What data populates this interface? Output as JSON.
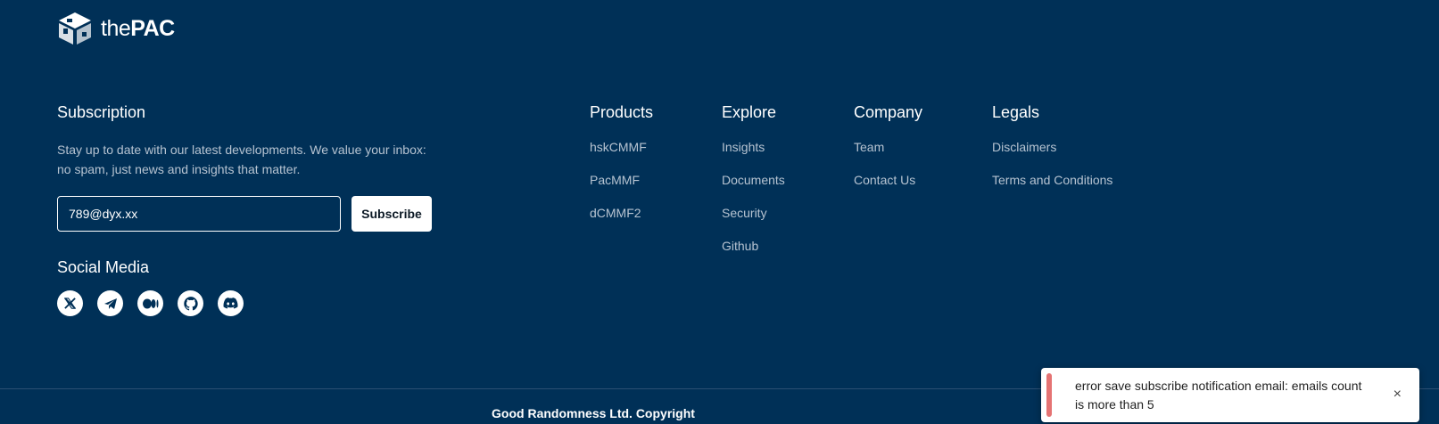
{
  "brand": {
    "logo_icon": "cube-logo-icon",
    "name_prefix": "the",
    "name_main": "PAC"
  },
  "subscription": {
    "title": "Subscription",
    "description": "Stay up to date with our latest developments. We value your inbox: no spam, just news and insights that matter.",
    "email_value": "789@dyx.xx",
    "subscribe_label": "Subscribe"
  },
  "social": {
    "title": "Social Media",
    "icons": [
      "x-twitter-icon",
      "telegram-icon",
      "medium-icon",
      "github-icon",
      "discord-icon"
    ]
  },
  "columns": [
    {
      "title": "Products",
      "links": [
        "hskCMMF",
        "PacMMF",
        "dCMMF2"
      ]
    },
    {
      "title": "Explore",
      "links": [
        "Insights",
        "Documents",
        "Security",
        "Github"
      ]
    },
    {
      "title": "Company",
      "links": [
        "Team",
        "Contact Us"
      ]
    },
    {
      "title": "Legals",
      "links": [
        "Disclaimers",
        "Terms and Conditions"
      ]
    }
  ],
  "footer": {
    "copyright": "Good Randomness Ltd. Copyright"
  },
  "toast": {
    "message": "error save subscribe notification email: emails count is more than 5",
    "close_symbol": "×"
  },
  "colors": {
    "background": "#003057",
    "muted_text": "#b6c3d1",
    "toast_accent": "#e57373"
  }
}
